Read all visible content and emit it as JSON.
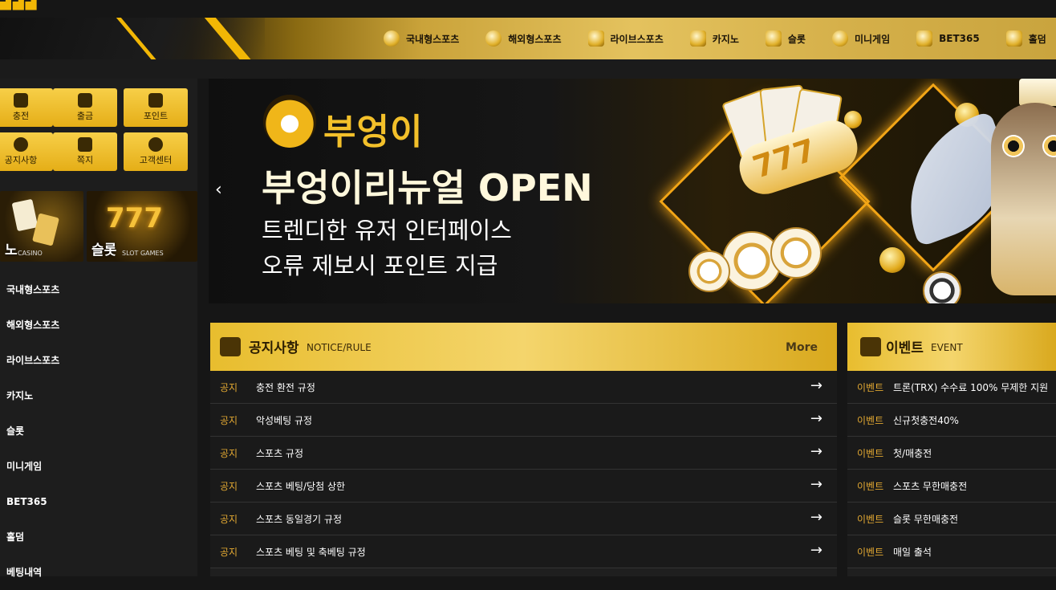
{
  "nav": {
    "items": [
      {
        "label": "국내형스포츠",
        "icon": "soccer-ball-icon"
      },
      {
        "label": "해외형스포츠",
        "icon": "basketball-icon"
      },
      {
        "label": "라이브스포츠",
        "icon": "live-tv-icon"
      },
      {
        "label": "카지노",
        "icon": "dice-icon"
      },
      {
        "label": "슬롯",
        "icon": "slot-machine-icon"
      },
      {
        "label": "미니게임",
        "icon": "coin-icon"
      },
      {
        "label": "BET365",
        "icon": "bet365-icon"
      },
      {
        "label": "홀덤",
        "icon": "cards-icon"
      }
    ]
  },
  "quick": [
    {
      "label": "충전",
      "icon": "deposit-icon"
    },
    {
      "label": "출금",
      "icon": "withdraw-icon"
    },
    {
      "label": "포인트",
      "icon": "point-transfer-icon"
    },
    {
      "label": "공지사항",
      "icon": "info-icon"
    },
    {
      "label": "쪽지",
      "icon": "mail-icon"
    },
    {
      "label": "고객센터",
      "icon": "support-chat-icon"
    }
  ],
  "thumbs": [
    {
      "label": "노",
      "sub": "CASINO"
    },
    {
      "label": "슬롯",
      "sub": "SLOT GAMES",
      "reels": "777"
    }
  ],
  "menu": [
    "국내형스포츠",
    "해외형스포츠",
    "라이브스포츠",
    "카지노",
    "슬롯",
    "미니게임",
    "BET365",
    "홀덤",
    "베팅내역"
  ],
  "banner": {
    "brand": "부엉이",
    "headline": "부엉이리뉴얼 OPEN",
    "line1": "트렌디한 유저 인터페이스",
    "line2": "오류 제보시 포인트 지급",
    "reels": "777"
  },
  "notice": {
    "title": "공지사항",
    "subtitle": "NOTICE/RULE",
    "more": "More",
    "rows": [
      {
        "tag": "공지",
        "text": "충전 환전 규정"
      },
      {
        "tag": "공지",
        "text": "악성베팅 규정"
      },
      {
        "tag": "공지",
        "text": "스포츠 규정"
      },
      {
        "tag": "공지",
        "text": "스포츠 베팅/당첨 상한"
      },
      {
        "tag": "공지",
        "text": "스포츠 동일경기 규정"
      },
      {
        "tag": "공지",
        "text": "스포츠 베팅 및 축베팅 규정"
      }
    ]
  },
  "event": {
    "title": "이벤트",
    "subtitle": "EVENT",
    "rows": [
      {
        "tag": "이벤트",
        "text": "트론(TRX) 수수료 100% 무제한 지원"
      },
      {
        "tag": "이벤트",
        "text": "신규첫충전40%"
      },
      {
        "tag": "이벤트",
        "text": "첫/매충전"
      },
      {
        "tag": "이벤트",
        "text": "스포츠 무한매충전"
      },
      {
        "tag": "이벤트",
        "text": "슬롯 무한매충전"
      },
      {
        "tag": "이벤트",
        "text": "매일 출석"
      }
    ]
  },
  "arrow": "→",
  "prev": "‹"
}
